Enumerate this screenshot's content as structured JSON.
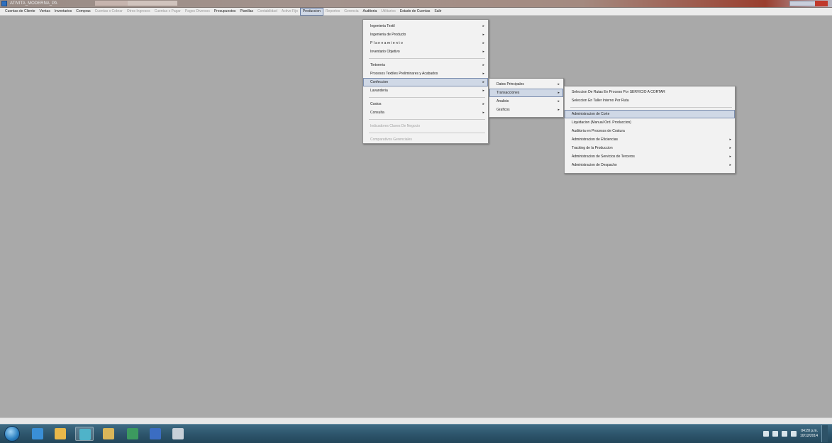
{
  "window": {
    "title": "ATIVITA_MODERNA_PA",
    "accent_active": "#cfd8e6"
  },
  "menubar": [
    {
      "label": "Cuentas de Cliente",
      "disabled": false
    },
    {
      "label": "Ventas",
      "disabled": false
    },
    {
      "label": "Inventarios",
      "disabled": false
    },
    {
      "label": "Compras",
      "disabled": false
    },
    {
      "label": "Cuentas x Cobrar",
      "disabled": true
    },
    {
      "label": "Otros Ingresos",
      "disabled": true
    },
    {
      "label": "Cuentas x Pagar",
      "disabled": true
    },
    {
      "label": "Pagos Diversos",
      "disabled": true
    },
    {
      "label": "Presupuestos",
      "disabled": false
    },
    {
      "label": "Planillas",
      "disabled": false
    },
    {
      "label": "Contabilidad",
      "disabled": true
    },
    {
      "label": "Activo Fijo",
      "disabled": true
    },
    {
      "label": "Produccion",
      "disabled": false,
      "active": true
    },
    {
      "label": "Reportes",
      "disabled": true
    },
    {
      "label": "Gerencia",
      "disabled": true
    },
    {
      "label": "Auditoria",
      "disabled": false
    },
    {
      "label": "Utilitarios",
      "disabled": true
    },
    {
      "label": "Estado de Cuentas",
      "disabled": false
    },
    {
      "label": "Salir",
      "disabled": false
    }
  ],
  "menu_level1": [
    {
      "label": "Ingenieria Textil",
      "sub": true
    },
    {
      "label": "Ingenieria de Producto",
      "sub": true
    },
    {
      "label": "P l a n e a m i e n t o",
      "sub": true
    },
    {
      "label": "Inventario Objetivo",
      "sub": true
    },
    {
      "sep": true
    },
    {
      "label": "Tintoreria",
      "sub": true
    },
    {
      "label": "Procesos Textiles Preliminares y Acabados",
      "sub": true
    },
    {
      "label": "Confeccion",
      "sub": true,
      "highlighted": true
    },
    {
      "label": "Lavanderia",
      "sub": true
    },
    {
      "sep": true
    },
    {
      "label": "Costos",
      "sub": true
    },
    {
      "label": "Consulta",
      "sub": true
    },
    {
      "sep": true
    },
    {
      "label": "Indicadores Claves De Negocio",
      "sub": false,
      "disabled": true
    },
    {
      "sep": true
    },
    {
      "label": "Comparativos Gerenciales",
      "sub": false,
      "disabled": true
    }
  ],
  "menu_level2": [
    {
      "label": "Datos Principales",
      "sub": true
    },
    {
      "label": "Transacciones",
      "sub": true,
      "highlighted": true
    },
    {
      "label": "Analisis",
      "sub": true
    },
    {
      "label": "Graficos",
      "sub": true
    }
  ],
  "menu_level3": [
    {
      "label": "Seleccion De Rutas En Proceso Por SERVICIO A CORTAR",
      "sub": false
    },
    {
      "label": "Seleccion En Taller Interno Por Ruta",
      "sub": false
    },
    {
      "sep": true
    },
    {
      "label": "Administracion de Corte",
      "sub": false,
      "highlighted": true
    },
    {
      "label": "Liquidacion (Manual Ord. Produccion)",
      "sub": false
    },
    {
      "label": "Auditoria en Procesos de Costura",
      "sub": false
    },
    {
      "label": "Administracion de Eficiencias",
      "sub": true
    },
    {
      "label": "Tracking de la Produccion",
      "sub": true
    },
    {
      "label": "Administracion de Servicios de Terceros",
      "sub": true
    },
    {
      "label": "Administracion de Despacho",
      "sub": true
    }
  ],
  "taskbar": {
    "clock_time": "04:20 p.m.",
    "clock_date": "10/12/2014",
    "apps": [
      {
        "name": "ie-icon",
        "color": "#3a8fd6"
      },
      {
        "name": "explorer-icon",
        "color": "#e8b84a"
      },
      {
        "name": "app-icon",
        "color": "#4fb3c9"
      },
      {
        "name": "folder-icon",
        "color": "#d9b659"
      },
      {
        "name": "excel-icon",
        "color": "#3c9a5f"
      },
      {
        "name": "word-icon",
        "color": "#3b6dc2"
      },
      {
        "name": "tool-icon",
        "color": "#c8d0d8"
      }
    ]
  }
}
